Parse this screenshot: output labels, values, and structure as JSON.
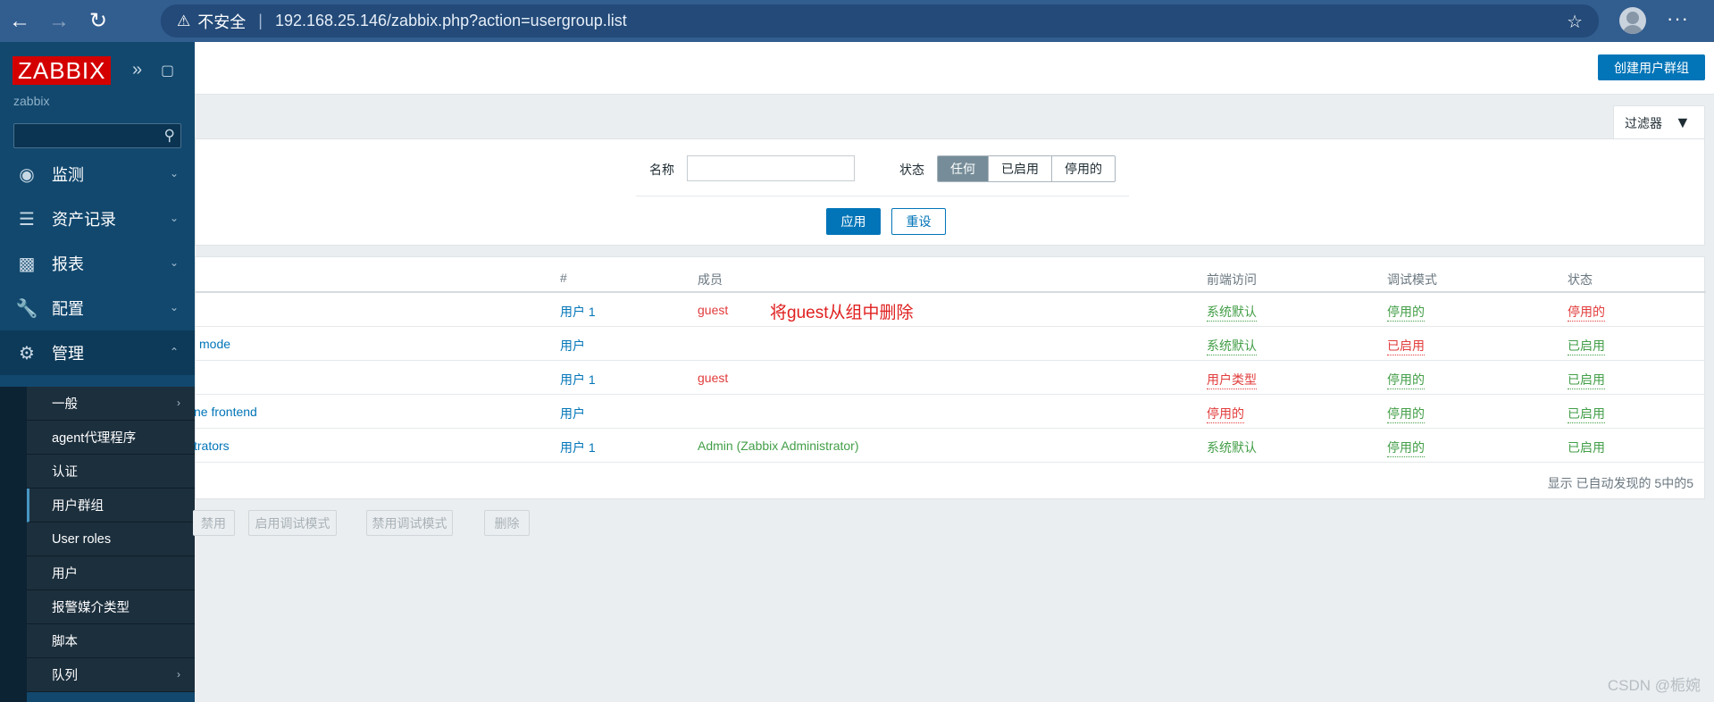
{
  "browser": {
    "back_icon": "arrow-left-icon",
    "forward_icon": "arrow-right-icon",
    "reload_icon": "reload-icon",
    "security_label": "不安全",
    "url": "192.168.25.146/zabbix.php?action=usergroup.list"
  },
  "sidebar": {
    "logo": "ZABBIX",
    "subtitle": "zabbix",
    "menu": [
      {
        "label": "监测",
        "icon": "eye-icon"
      },
      {
        "label": "资产记录",
        "icon": "list-icon"
      },
      {
        "label": "报表",
        "icon": "bar-chart-icon"
      },
      {
        "label": "配置",
        "icon": "wrench-icon"
      },
      {
        "label": "管理",
        "icon": "gear-icon"
      }
    ],
    "submenu": [
      "一般",
      "agent代理程序",
      "认证",
      "用户群组",
      "User roles",
      "用户",
      "报警媒介类型",
      "脚本",
      "队列"
    ]
  },
  "header": {
    "create_button": "创建用户群组"
  },
  "filter": {
    "tab_label": "过滤器",
    "name_label": "名称",
    "name_value": "",
    "status_label": "状态",
    "status_options": [
      "任何",
      "已启用",
      "停用的"
    ],
    "status_selected": "任何",
    "apply": "应用",
    "reset": "重设"
  },
  "table": {
    "headers": {
      "count": "#",
      "members": "成员",
      "frontend": "前端访问",
      "debug": "调试模式",
      "status": "状态"
    },
    "rows": [
      {
        "name": "",
        "count": "用户 1",
        "members": "guest",
        "frontend": "系统默认",
        "debug": "停用的",
        "status": "停用的"
      },
      {
        "name": "mode",
        "count": "用户",
        "members": "",
        "frontend": "系统默认",
        "debug": "已启用",
        "status": "已启用"
      },
      {
        "name": "",
        "count": "用户 1",
        "members": "guest",
        "frontend": "用户类型",
        "debug": "停用的",
        "status": "已启用"
      },
      {
        "name": "ne frontend",
        "count": "用户",
        "members": "",
        "frontend": "停用的",
        "debug": "停用的",
        "status": "已启用"
      },
      {
        "name": "trators",
        "count": "用户 1",
        "members": "Admin (Zabbix Administrator)",
        "frontend": "系统默认",
        "debug": "停用的",
        "status": "已启用"
      }
    ],
    "annotation": "将guest从组中删除",
    "footer": "显示 已自动发现的 5中的5"
  },
  "actions": [
    "禁用",
    "启用调试模式",
    "禁用调试模式",
    "删除"
  ],
  "watermark": "CSDN @栀婉"
}
